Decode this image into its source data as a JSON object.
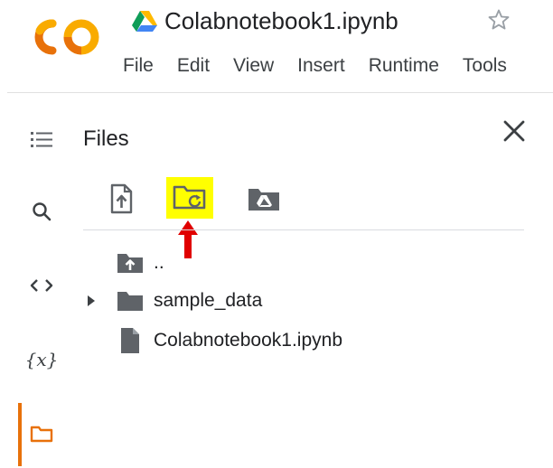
{
  "header": {
    "logo_text": "CO",
    "document_title": "Colabnotebook1.ipynb",
    "menu": [
      "File",
      "Edit",
      "View",
      "Insert",
      "Runtime",
      "Tools"
    ]
  },
  "rail": {
    "icons": [
      "table-of-contents-icon",
      "search-icon",
      "code-snippets-icon",
      "variables-icon",
      "files-folder-icon"
    ],
    "active": "files-folder-icon"
  },
  "files_panel": {
    "title": "Files",
    "toolbar": [
      "upload-file-icon",
      "refresh-folder-icon",
      "mount-drive-icon"
    ],
    "highlighted_tool": "refresh-folder-icon",
    "entries": [
      {
        "name": "..",
        "type": "parent",
        "icon": "folder-up-icon"
      },
      {
        "name": "sample_data",
        "type": "folder",
        "icon": "folder-icon"
      },
      {
        "name": "Colabnotebook1.ipynb",
        "type": "file",
        "icon": "file-icon"
      }
    ]
  },
  "colors": {
    "logo_orange": "#f9ab00",
    "logo_dark_orange": "#e8710a",
    "highlight": "#ffff00",
    "arrow_red": "#e00000",
    "icon_gray": "#5f6368",
    "text": "#202124"
  }
}
